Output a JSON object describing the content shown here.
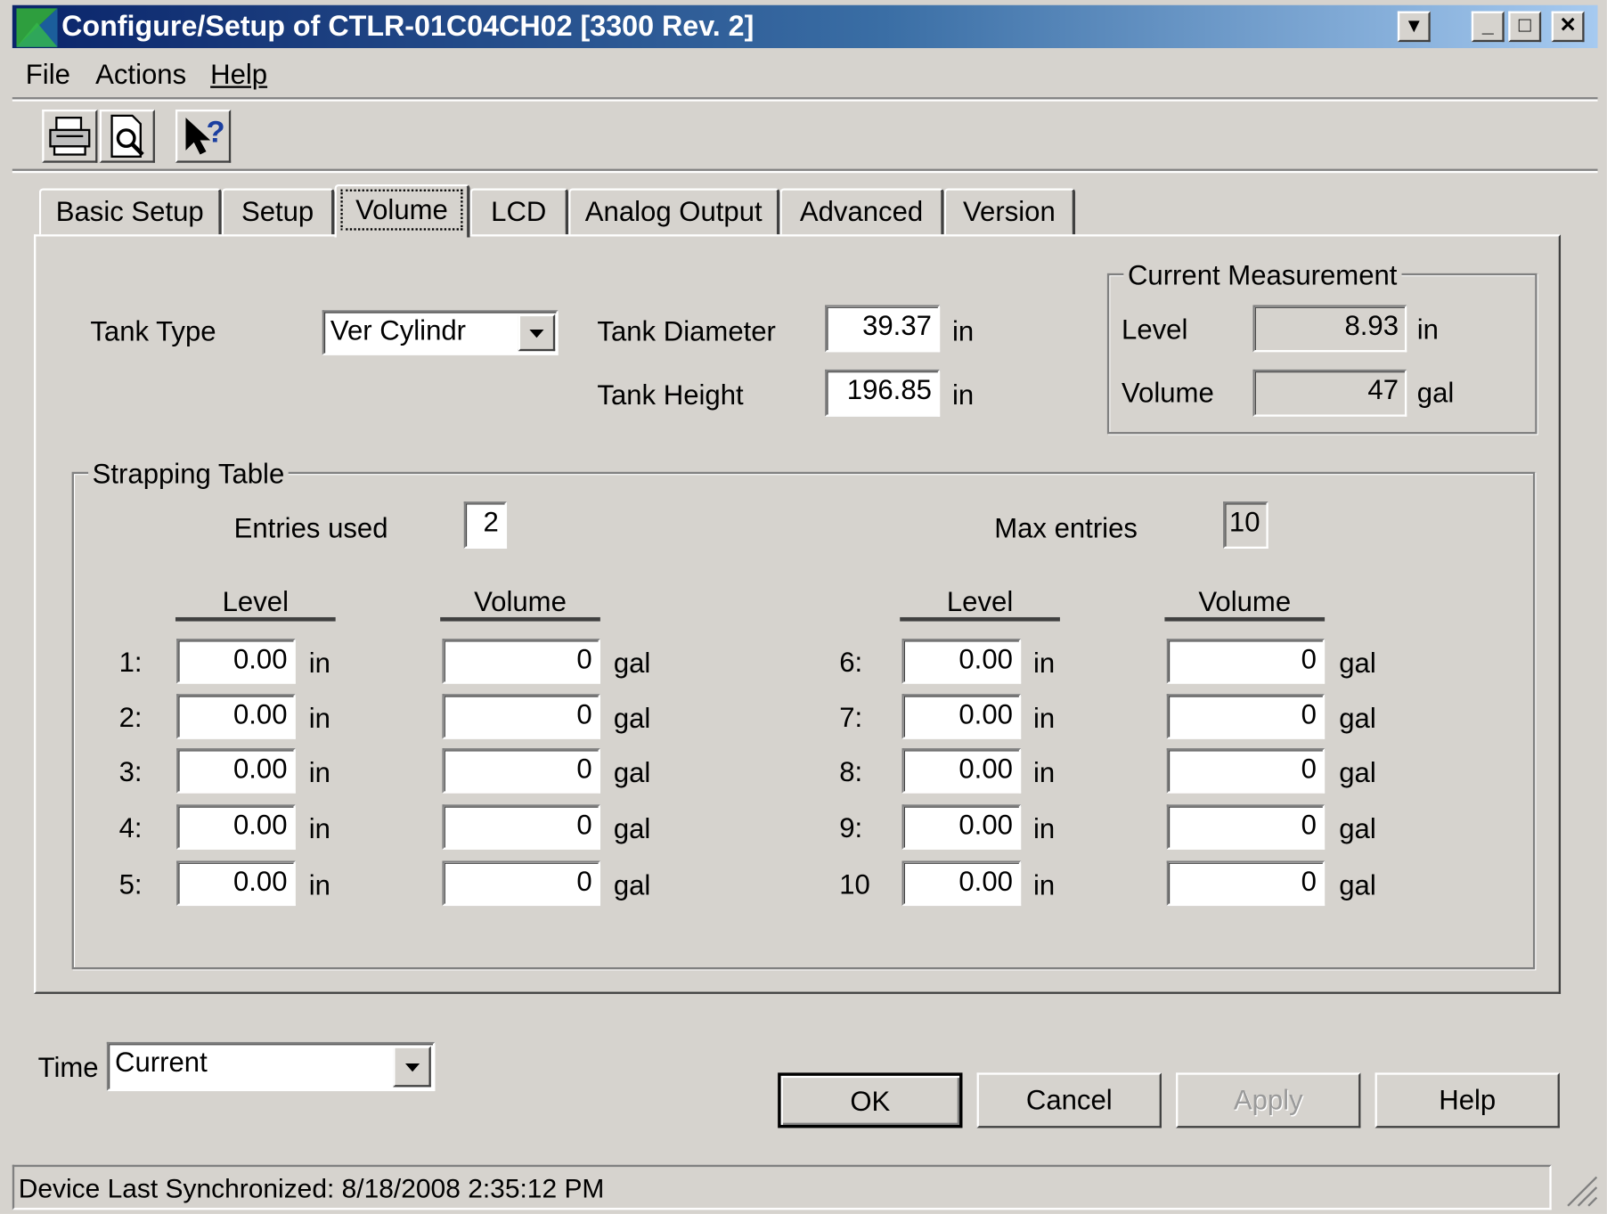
{
  "window": {
    "title": "Configure/Setup of CTLR-01C04CH02 [3300 Rev. 2]",
    "accent_color": "#0a246a"
  },
  "menu": {
    "items": [
      "File",
      "Actions",
      "Help"
    ]
  },
  "toolbar": {
    "buttons": [
      "print-icon",
      "print-preview-icon",
      "context-help-icon"
    ]
  },
  "tabs": {
    "items": [
      "Basic Setup",
      "Setup",
      "Volume",
      "LCD",
      "Analog Output",
      "Advanced",
      "Version"
    ],
    "active": "Volume"
  },
  "tank": {
    "type_label": "Tank Type",
    "type_value": "Ver Cylindr",
    "diameter_label": "Tank Diameter",
    "diameter_value": "39.37",
    "diameter_unit": "in",
    "height_label": "Tank Height",
    "height_value": "196.85",
    "height_unit": "in"
  },
  "current_measurement": {
    "title": "Current Measurement",
    "level_label": "Level",
    "level_value": "8.93",
    "level_unit": "in",
    "volume_label": "Volume",
    "volume_value": "47",
    "volume_unit": "gal"
  },
  "strapping": {
    "title": "Strapping Table",
    "entries_used_label": "Entries used",
    "entries_used_value": "2",
    "max_entries_label": "Max entries",
    "max_entries_value": "10",
    "level_header": "Level",
    "volume_header": "Volume",
    "rows": [
      {
        "index": "1:",
        "level": "0.00",
        "level_unit": "in",
        "volume": "0",
        "volume_unit": "gal"
      },
      {
        "index": "2:",
        "level": "0.00",
        "level_unit": "in",
        "volume": "0",
        "volume_unit": "gal"
      },
      {
        "index": "3:",
        "level": "0.00",
        "level_unit": "in",
        "volume": "0",
        "volume_unit": "gal"
      },
      {
        "index": "4:",
        "level": "0.00",
        "level_unit": "in",
        "volume": "0",
        "volume_unit": "gal"
      },
      {
        "index": "5:",
        "level": "0.00",
        "level_unit": "in",
        "volume": "0",
        "volume_unit": "gal"
      },
      {
        "index": "6:",
        "level": "0.00",
        "level_unit": "in",
        "volume": "0",
        "volume_unit": "gal"
      },
      {
        "index": "7:",
        "level": "0.00",
        "level_unit": "in",
        "volume": "0",
        "volume_unit": "gal"
      },
      {
        "index": "8:",
        "level": "0.00",
        "level_unit": "in",
        "volume": "0",
        "volume_unit": "gal"
      },
      {
        "index": "9:",
        "level": "0.00",
        "level_unit": "in",
        "volume": "0",
        "volume_unit": "gal"
      },
      {
        "index": "10",
        "level": "0.00",
        "level_unit": "in",
        "volume": "0",
        "volume_unit": "gal"
      }
    ]
  },
  "time": {
    "label": "Time",
    "value": "Current"
  },
  "buttons": {
    "ok": "OK",
    "cancel": "Cancel",
    "apply": "Apply",
    "help": "Help"
  },
  "status": {
    "text": "Device Last Synchronized: 8/18/2008 2:35:12 PM"
  }
}
